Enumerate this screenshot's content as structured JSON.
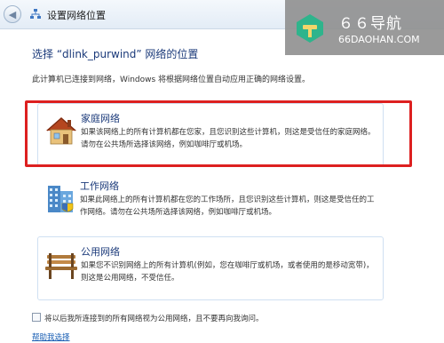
{
  "window": {
    "title": "设置网络位置"
  },
  "watermark": {
    "name": "６６导航",
    "url": "66DAOHAN.COM"
  },
  "page": {
    "heading": "选择 “dlink_purwind” 网络的位置",
    "intro": "此计算机已连接到网络，Windows 将根据网络位置自动应用正确的网络设置。"
  },
  "options": [
    {
      "title": "家庭网络",
      "description": "如果该网络上的所有计算机都在您家，且您识别这些计算机，则这是受信任的家庭网络。请勿在公共场所选择该网络，例如咖啡厅或机场。",
      "icon": "house-icon",
      "highlighted": true
    },
    {
      "title": "工作网络",
      "description": "如果此网络上的所有计算机都在您的工作场所，且您识别这些计算机，则这是受信任的工作网络。请勿在公共场所选择该网络，例如咖啡厅或机场。",
      "icon": "office-building-icon",
      "highlighted": false
    },
    {
      "title": "公用网络",
      "description": "如果您不识别网络上的所有计算机(例如，您在咖啡厅或机场，或者使用的是移动宽带)，则这是公用网络，不受信任。",
      "icon": "park-bench-icon",
      "highlighted": false
    }
  ],
  "checkbox": {
    "label": "将以后我所连接到的所有网络视为公用网络，且不要再向我询问。",
    "checked": false
  },
  "help": {
    "label": "帮助我选择"
  },
  "colors": {
    "highlight": "#dd2020",
    "heading": "#1b3a7a",
    "link": "#1a5fb4"
  }
}
